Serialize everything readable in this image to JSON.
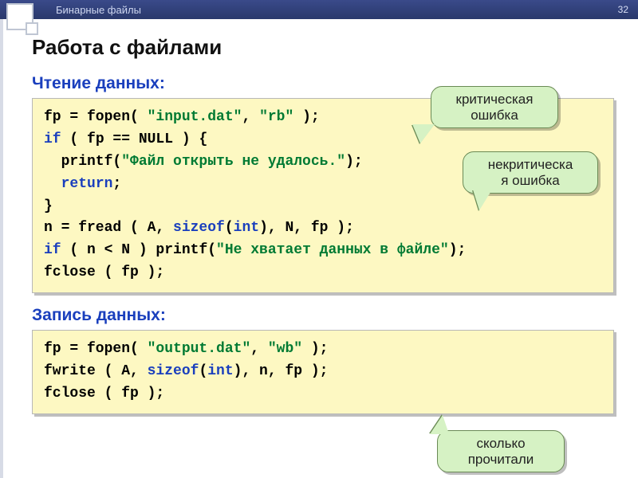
{
  "topbar": {
    "title": "Бинарные файлы",
    "page_number": "32"
  },
  "title": "Работа с файлами",
  "section1": "Чтение данных:",
  "section2": "Запись данных:",
  "callouts": {
    "critical": "критическая ошибка",
    "noncritical": "некритическа\nя ошибка",
    "howmany": "сколько прочитали"
  },
  "code1": {
    "l1a": "fp = fopen( ",
    "l1b": "\"input.dat\"",
    "l1c": ", ",
    "l1d": "\"rb\"",
    "l1e": " );",
    "l2a": "if",
    "l2b": " ( fp == NULL ) {",
    "l3a": "  printf(",
    "l3b": "\"Файл открыть не удалось.\"",
    "l3c": ");",
    "l4a": "  ",
    "l4b": "return",
    "l4c": ";",
    "l5": "}",
    "l6a": "n = fread ( A, ",
    "l6b": "sizeof",
    "l6c": "(",
    "l6d": "int",
    "l6e": "), N, fp );",
    "l7a": "if",
    "l7b": " ( n < N ) printf(",
    "l7c": "\"Не хватает данных в файле\"",
    "l7d": ");",
    "l8": "fclose ( fp );"
  },
  "code2": {
    "l1a": "fp = fopen( ",
    "l1b": "\"output.dat\"",
    "l1c": ", ",
    "l1d": "\"wb\"",
    "l1e": " );",
    "l2a": "fwrite ( A, ",
    "l2b": "sizeof",
    "l2c": "(",
    "l2d": "int",
    "l2e": "), n, fp );",
    "l3": "fclose ( fp );"
  }
}
